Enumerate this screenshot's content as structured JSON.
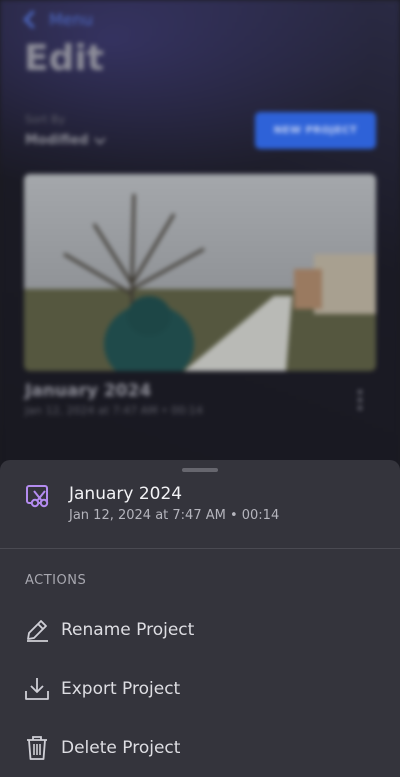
{
  "background": {
    "back_label": "Menu",
    "page_title": "Edit",
    "sort_label": "Sort By",
    "sort_value": "Modified",
    "new_project_label": "NEW PROJECT",
    "project": {
      "title": "January 2024",
      "meta": "Jan 12, 2024 at 7:47 AM • 00:14"
    }
  },
  "sheet": {
    "title": "January 2024",
    "meta": "Jan 12, 2024 at 7:47 AM • 00:14",
    "section_header": "ACTIONS",
    "actions": [
      {
        "label": "Rename Project",
        "icon": "pencil-icon"
      },
      {
        "label": "Export Project",
        "icon": "download-icon"
      },
      {
        "label": "Delete Project",
        "icon": "trash-icon"
      }
    ]
  },
  "colors": {
    "accent_blue": "#2e62d8",
    "sheet_bg": "#34343c",
    "project_icon": "#b48cf0"
  }
}
